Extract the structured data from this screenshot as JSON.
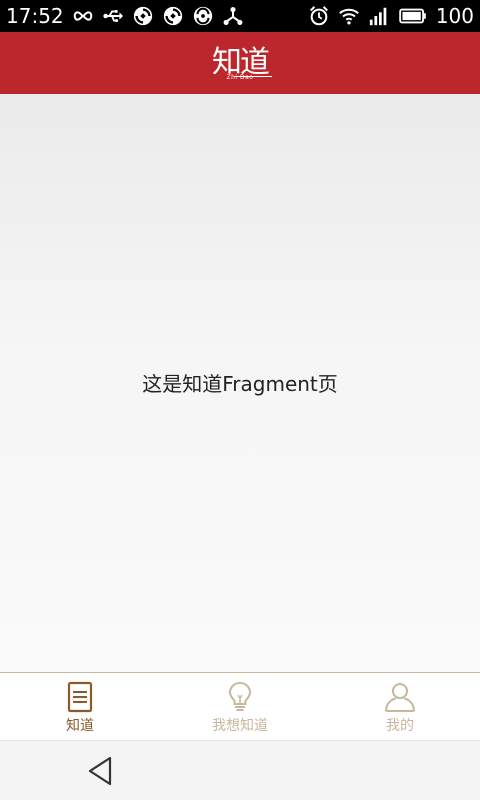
{
  "status_bar": {
    "time": "17:52",
    "battery": "100",
    "left_icons": [
      "infinity-icon",
      "usb-icon",
      "sync-icon",
      "sync-icon",
      "data-icon",
      "share-icon"
    ],
    "right_icons": [
      "alarm-icon",
      "wifi-icon",
      "signal-icon",
      "battery-icon"
    ]
  },
  "header": {
    "logo_text": "知道",
    "logo_sub": "Zhi Dao",
    "background_color": "#bb272c"
  },
  "main": {
    "text": "这是知道Fragment页"
  },
  "tabs": [
    {
      "label": "知道",
      "icon": "document-icon",
      "active": true
    },
    {
      "label": "我想知道",
      "icon": "lightbulb-icon",
      "active": false
    },
    {
      "label": "我的",
      "icon": "person-icon",
      "active": false
    }
  ],
  "colors": {
    "accent": "#bb272c",
    "tab_active": "#8a5a2b",
    "tab_inactive": "#c8b79b"
  },
  "nav_bar": {
    "back_icon": "back-triangle-icon"
  }
}
